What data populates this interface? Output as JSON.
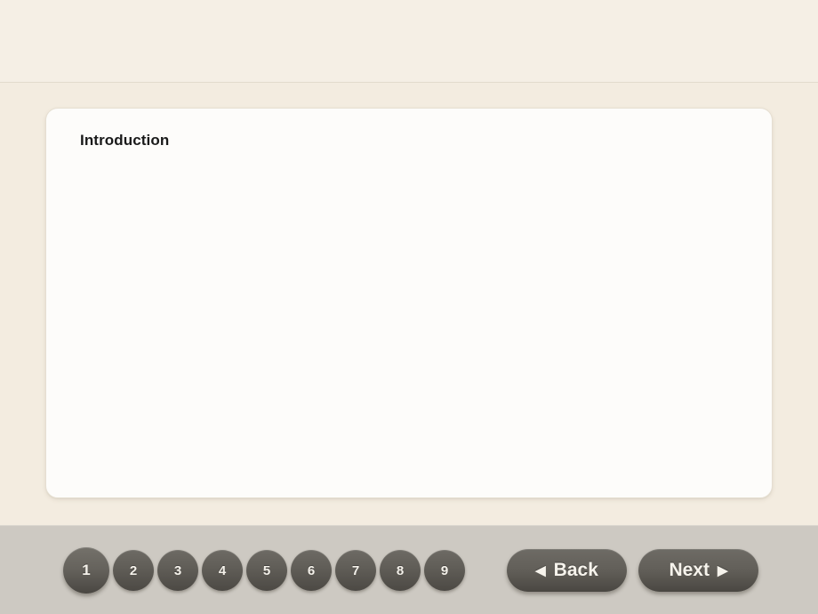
{
  "header": {
    "title": ""
  },
  "slide": {
    "title": "Introduction",
    "body": ""
  },
  "footer": {
    "pages": [
      {
        "label": "1",
        "active": true
      },
      {
        "label": "2",
        "active": false
      },
      {
        "label": "3",
        "active": false
      },
      {
        "label": "4",
        "active": false
      },
      {
        "label": "5",
        "active": false
      },
      {
        "label": "6",
        "active": false
      },
      {
        "label": "7",
        "active": false
      },
      {
        "label": "8",
        "active": false
      },
      {
        "label": "9",
        "active": false
      }
    ],
    "back_label": "Back",
    "back_icon": "triangle-left-icon",
    "back_arrow": "◀",
    "next_label": "Next",
    "next_icon": "triangle-right-icon",
    "next_arrow": "▶"
  },
  "colors": {
    "page_background": "#f3ece0",
    "header_background": "#f5efe5",
    "panel_background": "#fdfcfa",
    "panel_border": "#e6dfd2",
    "footer_background": "#cdc9c2",
    "button_dark": "#605d57",
    "button_text": "#f4f1ea",
    "title_text": "#1a1a1a"
  }
}
